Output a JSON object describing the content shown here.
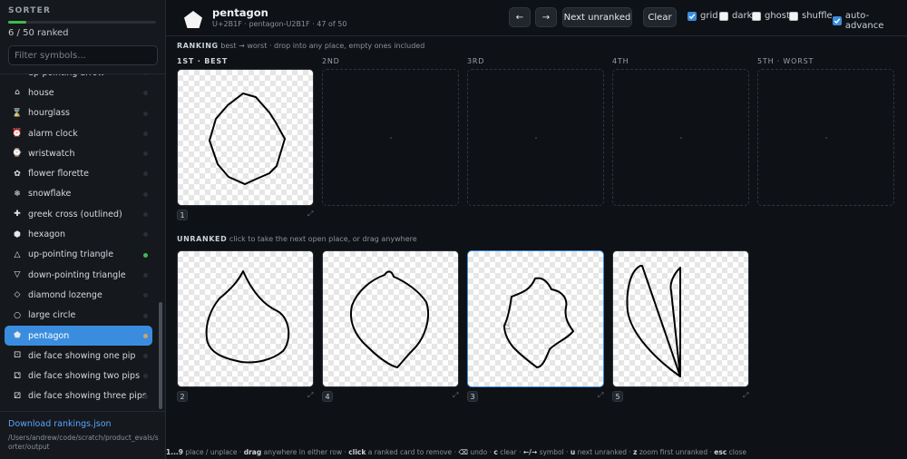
{
  "sidebar": {
    "title": "SORTER",
    "progress": 0.12,
    "count_text": "6 / 50 ranked",
    "filter_placeholder": "Filter symbols...",
    "items": [
      {
        "icon": "⬆",
        "label": "up-pointing arrow",
        "status": "none"
      },
      {
        "icon": "⌂",
        "label": "house",
        "status": "none"
      },
      {
        "icon": "⌛",
        "label": "hourglass",
        "status": "none"
      },
      {
        "icon": "⏰",
        "label": "alarm clock",
        "status": "none"
      },
      {
        "icon": "⌚",
        "label": "wristwatch",
        "status": "none"
      },
      {
        "icon": "✿",
        "label": "flower florette",
        "status": "none"
      },
      {
        "icon": "❄",
        "label": "snowflake",
        "status": "none"
      },
      {
        "icon": "✚",
        "label": "greek cross (outlined)",
        "status": "none"
      },
      {
        "icon": "⬢",
        "label": "hexagon",
        "status": "none"
      },
      {
        "icon": "△",
        "label": "up-pointing triangle",
        "status": "done"
      },
      {
        "icon": "▽",
        "label": "down-pointing triangle",
        "status": "none"
      },
      {
        "icon": "◇",
        "label": "diamond lozenge",
        "status": "none"
      },
      {
        "icon": "○",
        "label": "large circle",
        "status": "none"
      },
      {
        "icon": "⬟",
        "label": "pentagon",
        "status": "current",
        "active": true
      },
      {
        "icon": "⚀",
        "label": "die face showing one pip",
        "status": "none"
      },
      {
        "icon": "⚁",
        "label": "die face showing two pips",
        "status": "none"
      },
      {
        "icon": "⚂",
        "label": "die face showing three pips",
        "status": "none"
      }
    ],
    "download_label": "Download rankings.json",
    "output_path": "/Users/andrew/code/scratch/product_evals/sorter/output"
  },
  "header": {
    "symbol_name": "pentagon",
    "symbol_meta": "U+2B1F · pentagon-U2B1F · 47 of 50",
    "prev_label": "←",
    "next_label": "→",
    "next_unranked_label": "Next unranked",
    "clear_label": "Clear",
    "options": [
      {
        "label": "grid",
        "checked": true
      },
      {
        "label": "dark",
        "checked": false
      },
      {
        "label": "ghost",
        "checked": false
      },
      {
        "label": "shuffle",
        "checked": false
      },
      {
        "label": "auto-advance",
        "checked": true
      }
    ]
  },
  "ranking": {
    "title": "RANKING",
    "hint": "best → worst · drop into any place, empty ones included",
    "slots": [
      "1ST · BEST",
      "2ND",
      "3RD",
      "4TH",
      "5TH · WORST"
    ],
    "filled": [
      {
        "number": "1",
        "zoom": "⤢"
      }
    ]
  },
  "unranked": {
    "title": "UNRANKED",
    "hint": "click to take the next open place, or drag anywhere",
    "cards": [
      {
        "number": "2",
        "zoom": "⤢"
      },
      {
        "number": "4",
        "zoom": "⤢"
      },
      {
        "number": "3",
        "zoom": "⤢"
      },
      {
        "number": "5",
        "zoom": "⤢"
      }
    ]
  },
  "hints": [
    {
      "key": "1...9",
      "text": "place / unplace"
    },
    {
      "key": "drag",
      "text": "anywhere in either row"
    },
    {
      "key": "click",
      "text": "a ranked card to remove"
    },
    {
      "key": "⌫",
      "text": "undo"
    },
    {
      "key": "c",
      "text": "clear"
    },
    {
      "key": "←/→",
      "text": "symbol"
    },
    {
      "key": "u",
      "text": "next unranked"
    },
    {
      "key": "z",
      "text": "zoom first unranked"
    },
    {
      "key": "esc",
      "text": "close"
    }
  ],
  "colors": {
    "accent": "#3a8dde",
    "done": "#3fb950",
    "current": "#d2a464"
  }
}
